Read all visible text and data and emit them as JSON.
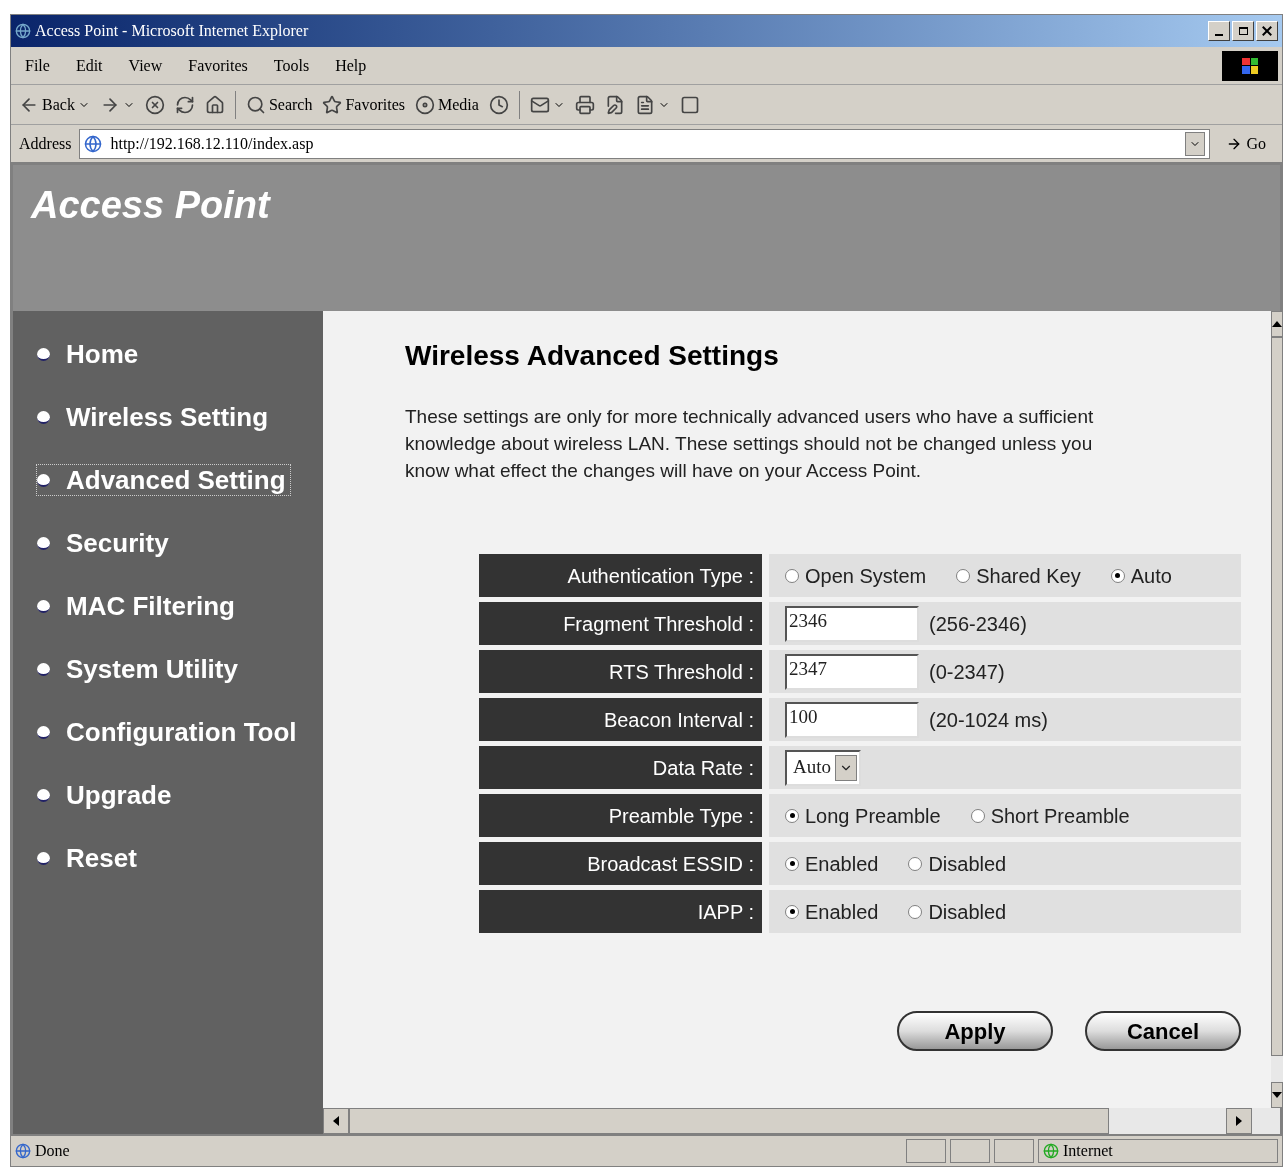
{
  "window": {
    "title": "Access Point - Microsoft Internet Explorer"
  },
  "menu": [
    "File",
    "Edit",
    "View",
    "Favorites",
    "Tools",
    "Help"
  ],
  "toolbar": [
    {
      "kind": "back",
      "label": "Back"
    },
    {
      "kind": "forward"
    },
    {
      "kind": "stop"
    },
    {
      "kind": "refresh"
    },
    {
      "kind": "home"
    },
    {
      "kind": "search",
      "label": "Search"
    },
    {
      "kind": "favorites",
      "label": "Favorites"
    },
    {
      "kind": "media",
      "label": "Media"
    },
    {
      "kind": "history"
    },
    {
      "kind": "mail"
    },
    {
      "kind": "print"
    },
    {
      "kind": "edit"
    },
    {
      "kind": "discuss"
    },
    {
      "kind": "messenger"
    }
  ],
  "address": {
    "label": "Address",
    "url": "http://192.168.12.110/index.asp",
    "go": "Go"
  },
  "page": {
    "banner": "Access Point",
    "sidebar": [
      {
        "label": "Home",
        "selected": false
      },
      {
        "label": "Wireless Setting",
        "selected": false
      },
      {
        "label": "Advanced Setting",
        "selected": true
      },
      {
        "label": "Security",
        "selected": false
      },
      {
        "label": "MAC Filtering",
        "selected": false
      },
      {
        "label": "System Utility",
        "selected": false
      },
      {
        "label": "Configuration Tool",
        "selected": false
      },
      {
        "label": "Upgrade",
        "selected": false
      },
      {
        "label": "Reset",
        "selected": false
      }
    ],
    "heading": "Wireless Advanced Settings",
    "description": "These settings are only for more technically advanced users who have a sufficient knowledge about wireless LAN. These settings should not be changed unless you know what effect the changes will have on your Access Point.",
    "form": [
      {
        "kind": "radio",
        "label": "Authentication Type :",
        "options": [
          {
            "label": "Open System",
            "selected": false
          },
          {
            "label": "Shared Key",
            "selected": false
          },
          {
            "label": "Auto",
            "selected": true
          }
        ]
      },
      {
        "kind": "text",
        "label": "Fragment Threshold :",
        "value": "2346",
        "hint": "(256-2346)"
      },
      {
        "kind": "text",
        "label": "RTS Threshold :",
        "value": "2347",
        "hint": "(0-2347)"
      },
      {
        "kind": "text",
        "label": "Beacon Interval :",
        "value": "100",
        "hint": "(20-1024 ms)"
      },
      {
        "kind": "select",
        "label": "Data Rate :",
        "value": "Auto"
      },
      {
        "kind": "radio",
        "label": "Preamble Type :",
        "options": [
          {
            "label": "Long Preamble",
            "selected": true
          },
          {
            "label": "Short Preamble",
            "selected": false
          }
        ]
      },
      {
        "kind": "radio",
        "label": "Broadcast ESSID :",
        "options": [
          {
            "label": "Enabled",
            "selected": true
          },
          {
            "label": "Disabled",
            "selected": false
          }
        ]
      },
      {
        "kind": "radio",
        "label": "IAPP :",
        "options": [
          {
            "label": "Enabled",
            "selected": true
          },
          {
            "label": "Disabled",
            "selected": false
          }
        ]
      }
    ],
    "buttons": [
      "Apply",
      "Cancel"
    ]
  },
  "status_bar": {
    "text": "Done",
    "zone": "Internet"
  }
}
